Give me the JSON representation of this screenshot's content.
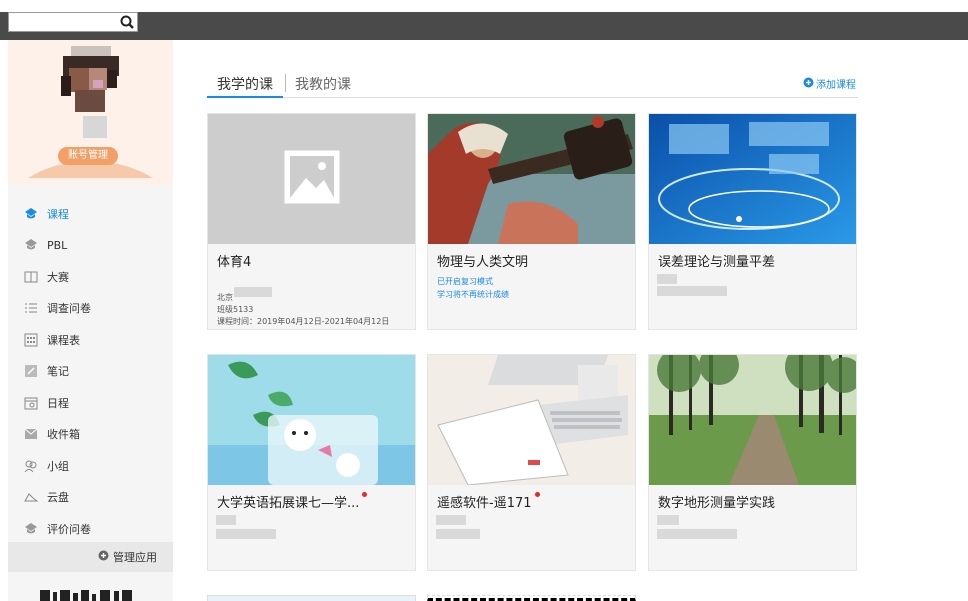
{
  "search": {
    "placeholder": ""
  },
  "sidebar": {
    "account_button": "账号管理",
    "items": [
      {
        "label": "课程",
        "icon": "course-icon",
        "active": true
      },
      {
        "label": "PBL",
        "icon": "pbl-icon"
      },
      {
        "label": "大赛",
        "icon": "contest-icon"
      },
      {
        "label": "调查问卷",
        "icon": "survey-icon"
      },
      {
        "label": "课程表",
        "icon": "timetable-icon"
      },
      {
        "label": "笔记",
        "icon": "notes-icon"
      },
      {
        "label": "日程",
        "icon": "calendar-icon"
      },
      {
        "label": "收件箱",
        "icon": "inbox-icon"
      },
      {
        "label": "小组",
        "icon": "group-icon"
      },
      {
        "label": "云盘",
        "icon": "cloud-icon"
      },
      {
        "label": "评价问卷",
        "icon": "evaluation-icon"
      }
    ],
    "manage_label": "管理应用"
  },
  "main": {
    "tabs": [
      {
        "label": "我学的课",
        "active": true
      },
      {
        "label": "我教的课"
      }
    ],
    "add_course": "添加课程",
    "courses": [
      {
        "title": "体育4",
        "lines": [
          "北京",
          "班级5133",
          "课程时间：2019年04月12日-2021年04月12日"
        ],
        "image": "placeholder"
      },
      {
        "title": "物理与人类文明",
        "lines": [
          "已开启复习模式",
          "学习将不再统计成绩"
        ],
        "image": "physics-painting"
      },
      {
        "title": "误差理论与测量平差",
        "lines": [],
        "image": "digital-globe"
      },
      {
        "title": "大学英语拓展课七—学...",
        "lines": [],
        "image": "cartoon-glass",
        "new": true
      },
      {
        "title": "遥感软件-遥171",
        "lines": [],
        "image": "tablet-desk",
        "new": true
      },
      {
        "title": "数字地形测量学实践",
        "lines": [],
        "image": "forest-path"
      }
    ]
  },
  "colors": {
    "accent": "#1a8ae5",
    "account_button": "#f2a068",
    "new_dot": "#e52a2a"
  }
}
